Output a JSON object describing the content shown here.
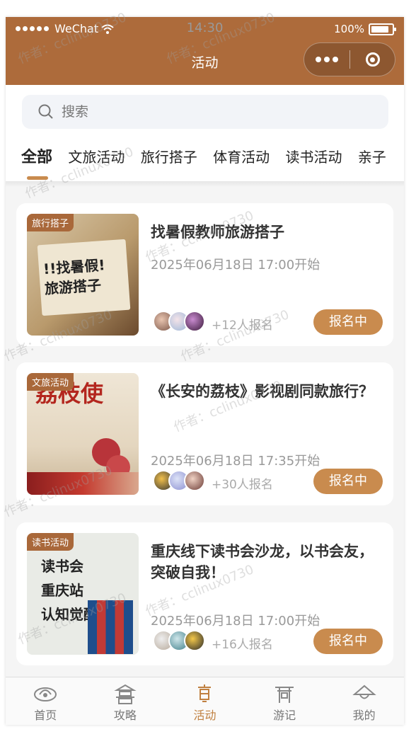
{
  "status": {
    "carrier": "WeChat",
    "time": "14:30",
    "battery": "100%"
  },
  "nav": {
    "title": "活动"
  },
  "search": {
    "placeholder": "搜索"
  },
  "tabs": [
    "全部",
    "文旅活动",
    "旅行搭子",
    "体育活动",
    "读书活动",
    "亲子"
  ],
  "activities": [
    {
      "tag": "旅行搭子",
      "title": "找暑假教师旅游搭子",
      "time": "2025年06月18日 17:00开始",
      "count": "+12人报名",
      "status": "报名中",
      "thumb_text": "!!找暑假!\n旅游搭子"
    },
    {
      "tag": "文旅活动",
      "title": "《长安的荔枝》影视剧同款旅行？",
      "time": "2025年06月18日 17:35开始",
      "count": "+30人报名",
      "status": "报名中",
      "thumb_text": "荔枝使"
    },
    {
      "tag": "读书活动",
      "title": "重庆线下读书会沙龙，以书会友，突破自我！",
      "time": "2025年06月18日 17:00开始",
      "count": "+16人报名",
      "status": "报名中",
      "thumb_text": "读书会\n重庆站\n认知觉醒"
    }
  ],
  "tabbar": [
    "首页",
    "攻略",
    "活动",
    "游记",
    "我的"
  ],
  "watermark": "作者：cclinux0730",
  "colors": {
    "brand": "#ad6b3b",
    "accent": "#c98b4e"
  }
}
